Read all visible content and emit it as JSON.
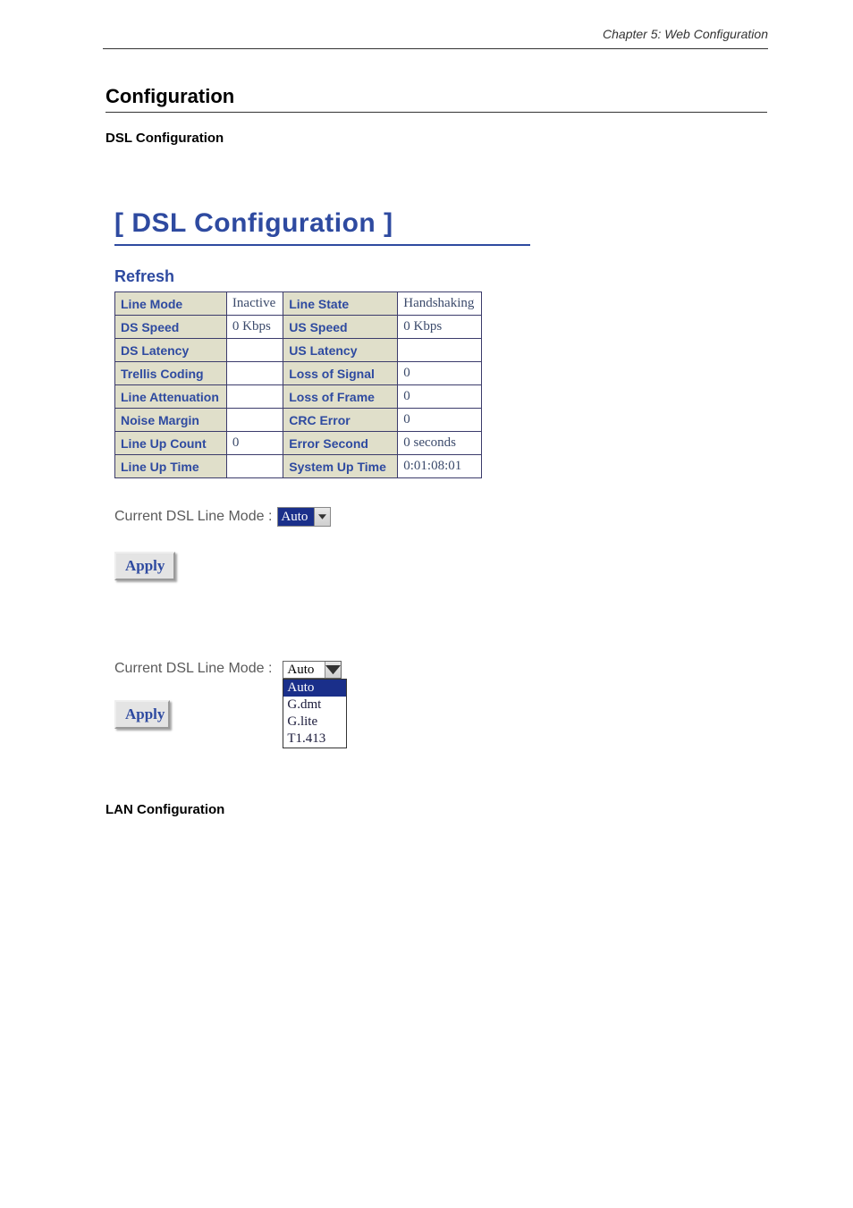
{
  "header": {
    "chapter": "Chapter 5: Web Configuration"
  },
  "section": {
    "title": "Configuration",
    "dsl_sub": "DSL Configuration",
    "lan_sub": "LAN Configuration"
  },
  "panel": {
    "title": "[ DSL Configuration ]",
    "refresh": "Refresh",
    "rows": [
      {
        "l1": "Line Mode",
        "v1": "Inactive",
        "l2": "Line State",
        "v2": "Handshaking"
      },
      {
        "l1": "DS Speed",
        "v1": "0 Kbps",
        "l2": "US Speed",
        "v2": "0 Kbps"
      },
      {
        "l1": "DS Latency",
        "v1": "",
        "l2": "US Latency",
        "v2": ""
      },
      {
        "l1": "Trellis Coding",
        "v1": "",
        "l2": "Loss of Signal",
        "v2": "0"
      },
      {
        "l1": "Line Attenuation",
        "v1": "",
        "l2": "Loss of Frame",
        "v2": "0"
      },
      {
        "l1": "Noise Margin",
        "v1": "",
        "l2": "CRC Error",
        "v2": "0"
      },
      {
        "l1": "Line Up Count",
        "v1": "0",
        "l2": "Error Second",
        "v2": "0 seconds"
      },
      {
        "l1": "Line Up Time",
        "v1": "",
        "l2": "System Up Time",
        "v2": "0:01:08:01"
      }
    ],
    "mode_label": "Current DSL Line Mode : ",
    "mode_selected": "Auto",
    "apply": "Apply",
    "dropdown": {
      "selected": "Auto",
      "options": [
        "Auto",
        "G.dmt",
        "G.lite",
        "T1.413"
      ]
    }
  }
}
